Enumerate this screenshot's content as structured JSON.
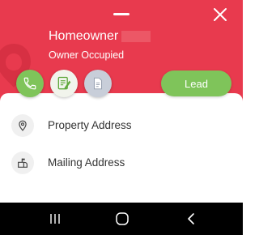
{
  "header": {
    "owner_name": "Homeowner",
    "owner_status": "Owner Occupied",
    "accent_color": "#e83a4e"
  },
  "actions": {
    "call_icon": "phone-icon",
    "note_icon": "edit-note-icon",
    "doc_icon": "document-icon",
    "lead_label": "Lead",
    "lead_color": "#7fc45a"
  },
  "rows": [
    {
      "icon": "map-pin-icon",
      "label": "Property Address"
    },
    {
      "icon": "mailbox-icon",
      "label": "Mailing Address"
    }
  ],
  "navbar": {
    "items": [
      "recent-apps-icon",
      "home-icon",
      "back-icon"
    ]
  }
}
